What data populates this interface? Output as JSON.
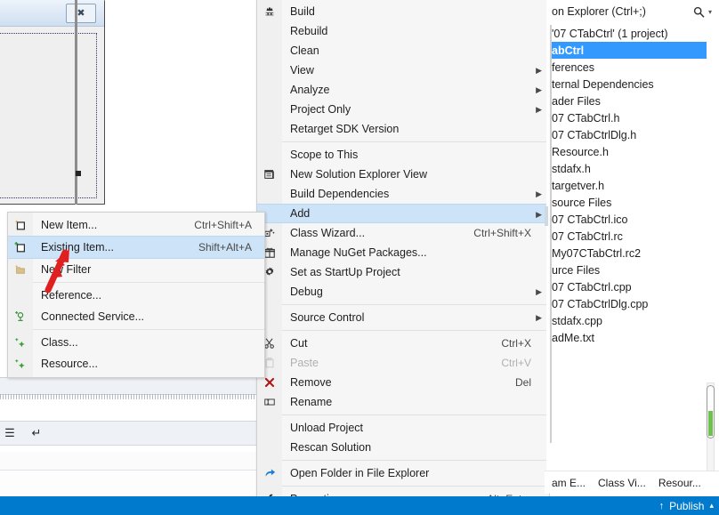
{
  "designer": {
    "dialog": {
      "close_glyph": "✖",
      "name": "dialog-preview"
    }
  },
  "context_menu": {
    "items": [
      {
        "label": "Build",
        "icon": "build-icon",
        "accel": "",
        "submenu": false,
        "selected": false,
        "disabled": false,
        "sep_after": false
      },
      {
        "label": "Rebuild",
        "icon": "",
        "accel": "",
        "submenu": false,
        "selected": false,
        "disabled": false,
        "sep_after": false
      },
      {
        "label": "Clean",
        "icon": "",
        "accel": "",
        "submenu": false,
        "selected": false,
        "disabled": false,
        "sep_after": false
      },
      {
        "label": "View",
        "icon": "",
        "accel": "",
        "submenu": true,
        "selected": false,
        "disabled": false,
        "sep_after": false
      },
      {
        "label": "Analyze",
        "icon": "",
        "accel": "",
        "submenu": true,
        "selected": false,
        "disabled": false,
        "sep_after": false
      },
      {
        "label": "Project Only",
        "icon": "",
        "accel": "",
        "submenu": true,
        "selected": false,
        "disabled": false,
        "sep_after": false
      },
      {
        "label": "Retarget SDK Version",
        "icon": "",
        "accel": "",
        "submenu": false,
        "selected": false,
        "disabled": false,
        "sep_after": true
      },
      {
        "label": "Scope to This",
        "icon": "",
        "accel": "",
        "submenu": false,
        "selected": false,
        "disabled": false,
        "sep_after": false
      },
      {
        "label": "New Solution Explorer View",
        "icon": "window-icon",
        "accel": "",
        "submenu": false,
        "selected": false,
        "disabled": false,
        "sep_after": false
      },
      {
        "label": "Build Dependencies",
        "icon": "",
        "accel": "",
        "submenu": true,
        "selected": false,
        "disabled": false,
        "sep_after": false
      },
      {
        "label": "Add",
        "icon": "",
        "accel": "",
        "submenu": true,
        "selected": true,
        "disabled": false,
        "sep_after": false
      },
      {
        "label": "Class Wizard...",
        "icon": "class-wizard-icon",
        "accel": "Ctrl+Shift+X",
        "submenu": false,
        "selected": false,
        "disabled": false,
        "sep_after": false
      },
      {
        "label": "Manage NuGet Packages...",
        "icon": "nuget-icon",
        "accel": "",
        "submenu": false,
        "selected": false,
        "disabled": false,
        "sep_after": false
      },
      {
        "label": "Set as StartUp Project",
        "icon": "gear-icon",
        "accel": "",
        "submenu": false,
        "selected": false,
        "disabled": false,
        "sep_after": false
      },
      {
        "label": "Debug",
        "icon": "",
        "accel": "",
        "submenu": true,
        "selected": false,
        "disabled": false,
        "sep_after": true
      },
      {
        "label": "Source Control",
        "icon": "",
        "accel": "",
        "submenu": true,
        "selected": false,
        "disabled": false,
        "sep_after": true
      },
      {
        "label": "Cut",
        "icon": "scissors-icon",
        "accel": "Ctrl+X",
        "submenu": false,
        "selected": false,
        "disabled": false,
        "sep_after": false
      },
      {
        "label": "Paste",
        "icon": "clipboard-icon",
        "accel": "Ctrl+V",
        "submenu": false,
        "selected": false,
        "disabled": true,
        "sep_after": false
      },
      {
        "label": "Remove",
        "icon": "remove-x-icon",
        "accel": "Del",
        "submenu": false,
        "selected": false,
        "disabled": false,
        "sep_after": false
      },
      {
        "label": "Rename",
        "icon": "rename-icon",
        "accel": "",
        "submenu": false,
        "selected": false,
        "disabled": false,
        "sep_after": true
      },
      {
        "label": "Unload Project",
        "icon": "",
        "accel": "",
        "submenu": false,
        "selected": false,
        "disabled": false,
        "sep_after": false
      },
      {
        "label": "Rescan Solution",
        "icon": "",
        "accel": "",
        "submenu": false,
        "selected": false,
        "disabled": false,
        "sep_after": true
      },
      {
        "label": "Open Folder in File Explorer",
        "icon": "open-folder-icon",
        "accel": "",
        "submenu": false,
        "selected": false,
        "disabled": false,
        "sep_after": true
      },
      {
        "label": "Properties",
        "icon": "wrench-icon",
        "accel": "Alt+Enter",
        "submenu": false,
        "selected": false,
        "disabled": false,
        "sep_after": false
      }
    ]
  },
  "add_submenu": {
    "items": [
      {
        "label": "New Item...",
        "icon": "new-item-icon",
        "accel": "Ctrl+Shift+A",
        "selected": false,
        "sep_after": false
      },
      {
        "label": "Existing Item...",
        "icon": "existing-item-icon",
        "accel": "Shift+Alt+A",
        "selected": true,
        "sep_after": false
      },
      {
        "label": "New Filter",
        "icon": "new-filter-icon",
        "accel": "",
        "selected": false,
        "sep_after": true
      },
      {
        "label": "Reference...",
        "icon": "",
        "accel": "",
        "selected": false,
        "sep_after": false
      },
      {
        "label": "Connected Service...",
        "icon": "connected-service-icon",
        "accel": "",
        "selected": false,
        "sep_after": true
      },
      {
        "label": "Class...",
        "icon": "class-icon",
        "accel": "",
        "selected": false,
        "sep_after": false
      },
      {
        "label": "Resource...",
        "icon": "resource-icon",
        "accel": "",
        "selected": false,
        "sep_after": false
      }
    ]
  },
  "solution_explorer": {
    "title": "on Explorer (Ctrl+;)",
    "search_icon": "search-icon",
    "search_caret": "▾",
    "tree": [
      {
        "label": "'07 CTabCtrl' (1 project)",
        "selected": false
      },
      {
        "label": "abCtrl",
        "selected": true
      },
      {
        "label": "ferences",
        "selected": false
      },
      {
        "label": "ternal Dependencies",
        "selected": false
      },
      {
        "label": "ader Files",
        "selected": false
      },
      {
        "label": "07 CTabCtrl.h",
        "selected": false
      },
      {
        "label": "07 CTabCtrlDlg.h",
        "selected": false
      },
      {
        "label": "Resource.h",
        "selected": false
      },
      {
        "label": "stdafx.h",
        "selected": false
      },
      {
        "label": "targetver.h",
        "selected": false
      },
      {
        "label": "source Files",
        "selected": false
      },
      {
        "label": "07 CTabCtrl.ico",
        "selected": false
      },
      {
        "label": "07 CTabCtrl.rc",
        "selected": false
      },
      {
        "label": "My07CTabCtrl.rc2",
        "selected": false
      },
      {
        "label": "urce Files",
        "selected": false
      },
      {
        "label": "07 CTabCtrl.cpp",
        "selected": false
      },
      {
        "label": "07 CTabCtrlDlg.cpp",
        "selected": false
      },
      {
        "label": "stdafx.cpp",
        "selected": false
      },
      {
        "label": "adMe.txt",
        "selected": false
      }
    ],
    "tabs": [
      {
        "label": "am E..."
      },
      {
        "label": "Class Vi..."
      },
      {
        "label": "Resour..."
      }
    ]
  },
  "status_bar": {
    "publish_label": "Publish",
    "publish_up_arrow": "↑",
    "publish_caret": "▴",
    "accent_color": "#007acc"
  },
  "colors": {
    "menu_bg": "#f6f6f6",
    "menu_gutter": "#f0f0f0",
    "menu_selected": "#cde3f8",
    "tree_selected": "#3399ff",
    "status_blue": "#007acc",
    "annotation_red": "#e02020",
    "scroll_green": "#6cc24a"
  }
}
